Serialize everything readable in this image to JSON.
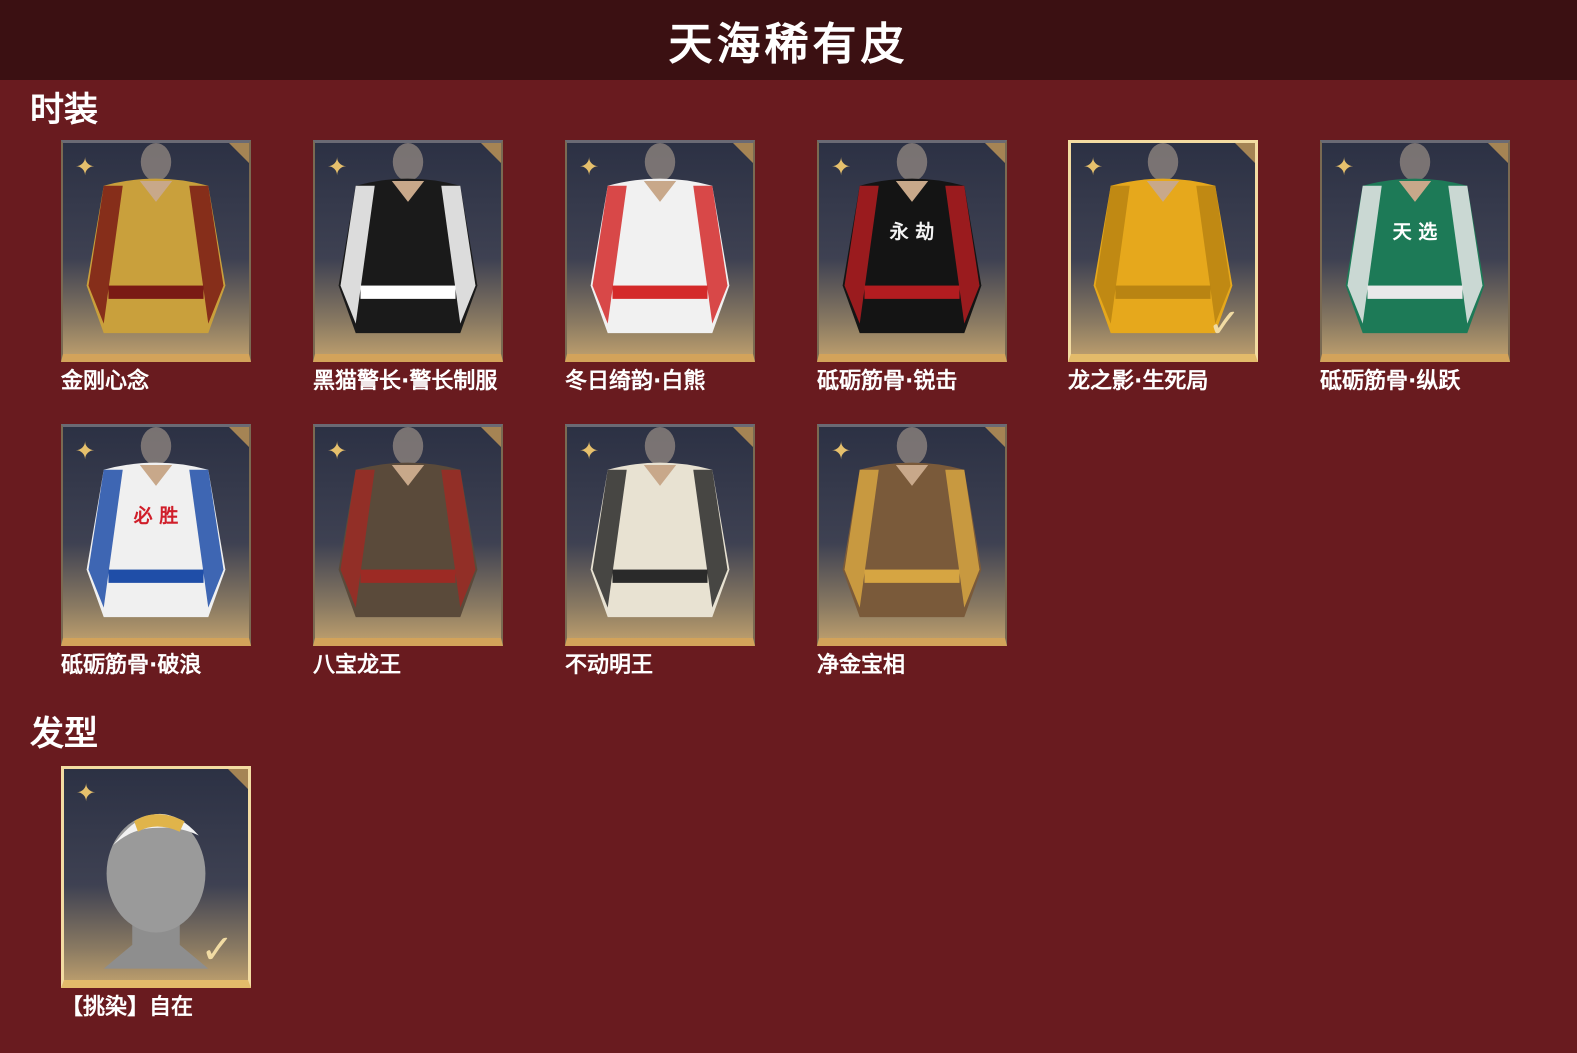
{
  "header": {
    "title": "天海稀有皮"
  },
  "sections": [
    {
      "title": "时装",
      "items": [
        {
          "label": "金刚心念",
          "palette": {
            "body": "#c9a03c",
            "accent": "#7a1a14"
          },
          "selected": false
        },
        {
          "label": "黑猫警长·警长制服",
          "palette": {
            "body": "#1a1a1a",
            "accent": "#ffffff"
          },
          "selected": false
        },
        {
          "label": "冬日绮韵·白熊",
          "palette": {
            "body": "#f1f1f1",
            "accent": "#d42a2a"
          },
          "selected": false
        },
        {
          "label": "砥砺筋骨·锐击",
          "palette": {
            "body": "#141414",
            "accent": "#b21c20"
          },
          "chest_text": "永 劫",
          "selected": false
        },
        {
          "label": "龙之影·生死局",
          "palette": {
            "body": "#e6a81c",
            "accent": "#b98412"
          },
          "selected": true
        },
        {
          "label": "砥砺筋骨·纵跃",
          "palette": {
            "body": "#1d7a57",
            "accent": "#e9e9e9"
          },
          "chest_text": "天 选",
          "selected": false
        },
        {
          "label": "砥砺筋骨·破浪",
          "palette": {
            "body": "#f0f0f0",
            "accent": "#1f4ea8"
          },
          "chest_text": "必 胜",
          "selected": false
        },
        {
          "label": "八宝龙王",
          "palette": {
            "body": "#5a4a3a",
            "accent": "#9c2a24"
          },
          "selected": false
        },
        {
          "label": "不动明王",
          "palette": {
            "body": "#e8e2d2",
            "accent": "#2a2a2a"
          },
          "selected": false
        },
        {
          "label": "净金宝相",
          "palette": {
            "body": "#7a5a3a",
            "accent": "#d6a542"
          },
          "selected": false
        }
      ]
    },
    {
      "title": "发型",
      "items": [
        {
          "label": "【挑染】自在",
          "palette": {
            "body": "#9a9a9a",
            "accent": "#e0b44a"
          },
          "selected": true
        }
      ]
    }
  ],
  "icons": {
    "rarity": "sparkle-icon",
    "corner": "corner-tag-icon",
    "selected": "check-icon"
  },
  "check_glyph": "✓",
  "sparkle_glyph": "✦"
}
